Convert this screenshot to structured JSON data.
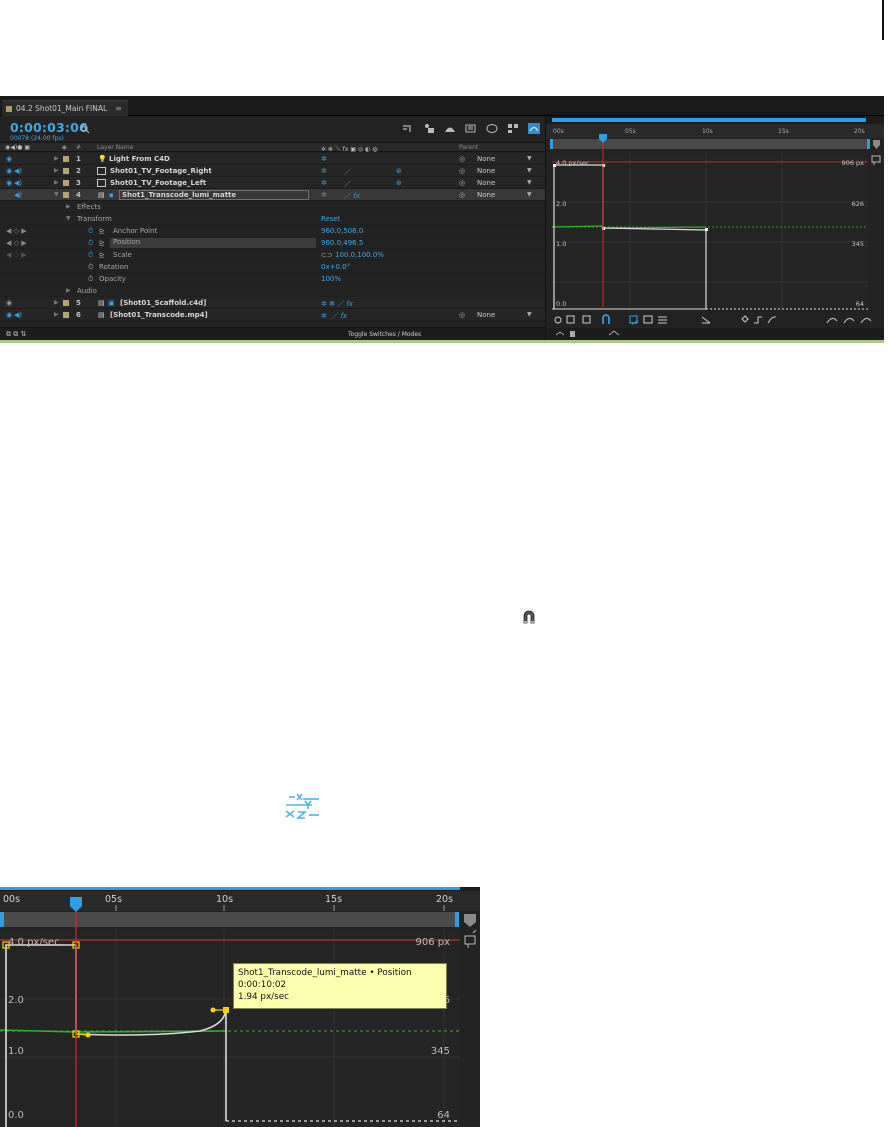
{
  "panel": {
    "tab_title": "04.2 Shot01_Main FINAL",
    "tab_menu": "≡",
    "timecode": "0:00:03:06",
    "fps_line": "00078 (24.00 fps)",
    "search_placeholder": "",
    "columns": {
      "layer_name": "Layer Name",
      "hash": "#",
      "parent": "Parent"
    },
    "footer_label": "Toggle Switches / Modes",
    "accent_color": "#43a6e6"
  },
  "layers": [
    {
      "num": "1",
      "name": "Light From C4D",
      "type": "light",
      "label_color": "#b5a27a",
      "parent": "None",
      "eye": "◉",
      "audio": ""
    },
    {
      "num": "2",
      "name": "Shot01_TV_Footage_Right",
      "type": "footage",
      "label_color": "#b5a27a",
      "parent": "None",
      "eye": "◉",
      "audio": "◀)"
    },
    {
      "num": "3",
      "name": "Shot01_TV_Footage_Left",
      "type": "footage",
      "label_color": "#b5a27a",
      "parent": "None",
      "eye": "◉",
      "audio": "◀)"
    },
    {
      "num": "4",
      "name": "Shot1_Transcode_lumi_matte",
      "type": "comp",
      "label_color": "#b5a27a",
      "parent": "None",
      "eye": "",
      "audio": "◀)"
    },
    {
      "num": "5",
      "name": "[Shot01_Scaffold.c4d]",
      "type": "c4d",
      "label_color": "#b5a27a",
      "parent": "",
      "eye": "◉",
      "audio": ""
    },
    {
      "num": "6",
      "name": "[Shot01_Transcode.mp4]",
      "type": "footage",
      "label_color": "#b5a27a",
      "parent": "None",
      "eye": "◉",
      "audio": "◀)"
    }
  ],
  "groups": {
    "effects": "Effects",
    "transform": "Transform",
    "reset": "Reset",
    "audio": "Audio"
  },
  "properties": [
    {
      "name": "Anchor Point",
      "value": "960.0,506.0"
    },
    {
      "name": "Position",
      "value": "960.0,496.5"
    },
    {
      "name": "Scale",
      "value": "100.0,100.0%"
    },
    {
      "name": "Rotation",
      "value": "0x+0.0°"
    },
    {
      "name": "Opacity",
      "value": "100%"
    }
  ],
  "graph_small": {
    "ruler": [
      "00s",
      "05s",
      "10s",
      "15s",
      "20s"
    ],
    "left_axis": [
      "4.0 px/sec",
      "2.0",
      "1.0",
      "0.0"
    ],
    "right_axis": [
      "906 px",
      "626",
      "345",
      "64"
    ]
  },
  "graph_big": {
    "ruler": [
      "00s",
      "05s",
      "10s",
      "15s",
      "20s"
    ],
    "left_axis": [
      "4.0 px/sec",
      "2.0",
      "1.0",
      "0.0"
    ],
    "right_axis": [
      "906 px",
      "626",
      "345",
      "64"
    ],
    "tooltip": {
      "title": "Shot1_Transcode_lumi_matte • Position",
      "time": "0:00:10:02",
      "value": "1.94 px/sec"
    }
  },
  "icons": {
    "snap": "snap-magnet-icon",
    "separate_dimensions": "separate-dimensions-icon"
  }
}
